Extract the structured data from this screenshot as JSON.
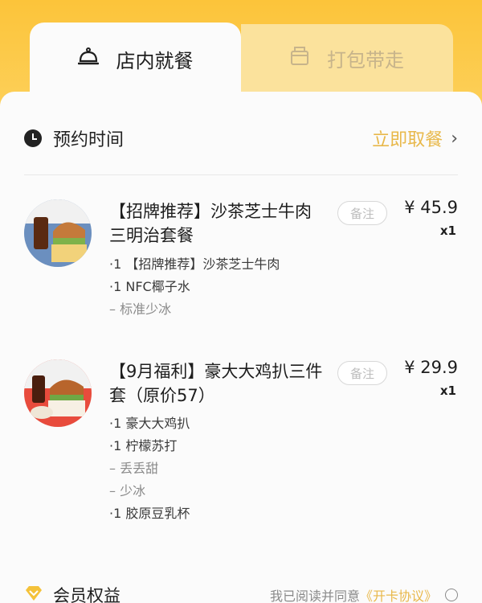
{
  "tabs": {
    "dine_in": "店内就餐",
    "takeout": "打包带走"
  },
  "reservation": {
    "label": "预约时间",
    "value": "立即取餐",
    "chevron": "›"
  },
  "items": [
    {
      "name": "【招牌推荐】沙茶芝士牛肉三明治套餐",
      "note": "备注",
      "price": "¥ 45.9",
      "qty": "x1",
      "subs": [
        {
          "text": "·1 【招牌推荐】沙茶芝士牛肉",
          "type": "item"
        },
        {
          "text": "·1 NFC椰子水",
          "type": "item"
        },
        {
          "text": "– 标准少冰",
          "type": "option"
        }
      ]
    },
    {
      "name": "【9月福利】豪大大鸡扒三件套（原价57）",
      "note": "备注",
      "price": "¥ 29.9",
      "qty": "x1",
      "subs": [
        {
          "text": "·1 豪大大鸡扒",
          "type": "item"
        },
        {
          "text": "·1 柠檬苏打",
          "type": "item"
        },
        {
          "text": "– 丢丢甜",
          "type": "option"
        },
        {
          "text": "– 少冰",
          "type": "option"
        },
        {
          "text": "·1 胶原豆乳杯",
          "type": "item"
        }
      ]
    }
  ],
  "member": {
    "label": "会员权益",
    "agree_text": "我已阅读并同意",
    "agree_link": "《开卡协议》"
  },
  "colors": {
    "brand_yellow": "#fcc43a",
    "accent_gold": "#e8b84a"
  }
}
